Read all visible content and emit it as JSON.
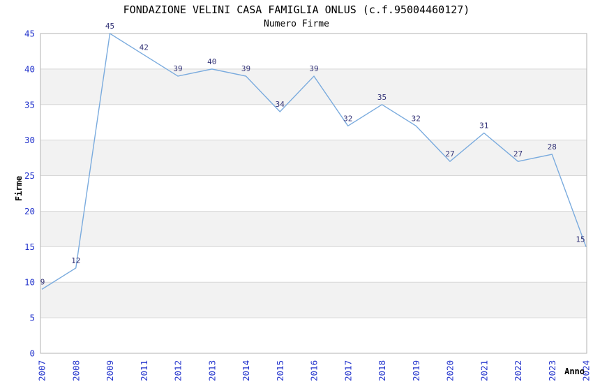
{
  "header": {
    "title": "FONDAZIONE VELINI CASA FAMIGLIA ONLUS (c.f.95004460127)",
    "subtitle": "Numero Firme"
  },
  "chart_data": {
    "type": "line",
    "title": "FONDAZIONE VELINI CASA FAMIGLIA ONLUS (c.f.95004460127)",
    "subtitle": "Numero Firme",
    "xlabel": "Anno",
    "ylabel": "Firme",
    "categories": [
      "2007",
      "2008",
      "2009",
      "2011",
      "2012",
      "2013",
      "2014",
      "2015",
      "2016",
      "2017",
      "2018",
      "2019",
      "2020",
      "2021",
      "2022",
      "2023",
      "2024"
    ],
    "values": [
      9,
      12,
      45,
      42,
      39,
      40,
      39,
      34,
      39,
      32,
      35,
      32,
      27,
      31,
      27,
      28,
      15
    ],
    "ylim": [
      0,
      45
    ],
    "ytick_step": 5,
    "yticks": [
      0,
      5,
      10,
      15,
      20,
      25,
      30,
      35,
      40,
      45
    ],
    "grid": true,
    "legend_position": "none",
    "point_labels_visible": true,
    "colors": {
      "line": "#7aabde",
      "tick_label": "#2233cc",
      "point_label": "#333377",
      "band": "#f2f2f2",
      "band_alt": "#ffffff",
      "gridline": "#d8d8d8",
      "border": "#b3b3b3",
      "text": "#000000",
      "background": "#ffffff"
    }
  }
}
